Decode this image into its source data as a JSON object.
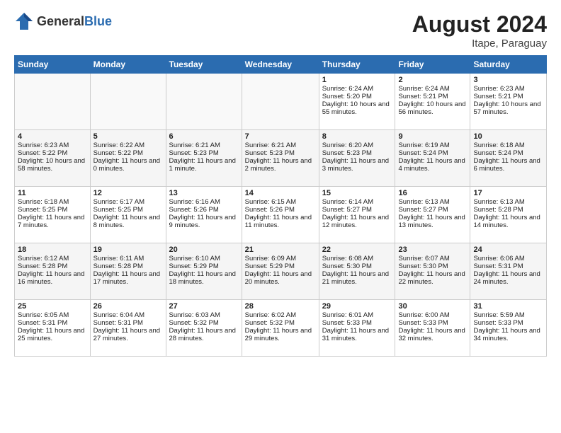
{
  "header": {
    "logo_general": "General",
    "logo_blue": "Blue",
    "month_year": "August 2024",
    "location": "Itape, Paraguay"
  },
  "days_of_week": [
    "Sunday",
    "Monday",
    "Tuesday",
    "Wednesday",
    "Thursday",
    "Friday",
    "Saturday"
  ],
  "weeks": [
    [
      {
        "day": "",
        "sunrise": "",
        "sunset": "",
        "daylight": "",
        "empty": true
      },
      {
        "day": "",
        "sunrise": "",
        "sunset": "",
        "daylight": "",
        "empty": true
      },
      {
        "day": "",
        "sunrise": "",
        "sunset": "",
        "daylight": "",
        "empty": true
      },
      {
        "day": "",
        "sunrise": "",
        "sunset": "",
        "daylight": "",
        "empty": true
      },
      {
        "day": "1",
        "sunrise": "Sunrise: 6:24 AM",
        "sunset": "Sunset: 5:20 PM",
        "daylight": "Daylight: 10 hours and 55 minutes.",
        "empty": false
      },
      {
        "day": "2",
        "sunrise": "Sunrise: 6:24 AM",
        "sunset": "Sunset: 5:21 PM",
        "daylight": "Daylight: 10 hours and 56 minutes.",
        "empty": false
      },
      {
        "day": "3",
        "sunrise": "Sunrise: 6:23 AM",
        "sunset": "Sunset: 5:21 PM",
        "daylight": "Daylight: 10 hours and 57 minutes.",
        "empty": false
      }
    ],
    [
      {
        "day": "4",
        "sunrise": "Sunrise: 6:23 AM",
        "sunset": "Sunset: 5:22 PM",
        "daylight": "Daylight: 10 hours and 58 minutes.",
        "empty": false
      },
      {
        "day": "5",
        "sunrise": "Sunrise: 6:22 AM",
        "sunset": "Sunset: 5:22 PM",
        "daylight": "Daylight: 11 hours and 0 minutes.",
        "empty": false
      },
      {
        "day": "6",
        "sunrise": "Sunrise: 6:21 AM",
        "sunset": "Sunset: 5:23 PM",
        "daylight": "Daylight: 11 hours and 1 minute.",
        "empty": false
      },
      {
        "day": "7",
        "sunrise": "Sunrise: 6:21 AM",
        "sunset": "Sunset: 5:23 PM",
        "daylight": "Daylight: 11 hours and 2 minutes.",
        "empty": false
      },
      {
        "day": "8",
        "sunrise": "Sunrise: 6:20 AM",
        "sunset": "Sunset: 5:23 PM",
        "daylight": "Daylight: 11 hours and 3 minutes.",
        "empty": false
      },
      {
        "day": "9",
        "sunrise": "Sunrise: 6:19 AM",
        "sunset": "Sunset: 5:24 PM",
        "daylight": "Daylight: 11 hours and 4 minutes.",
        "empty": false
      },
      {
        "day": "10",
        "sunrise": "Sunrise: 6:18 AM",
        "sunset": "Sunset: 5:24 PM",
        "daylight": "Daylight: 11 hours and 6 minutes.",
        "empty": false
      }
    ],
    [
      {
        "day": "11",
        "sunrise": "Sunrise: 6:18 AM",
        "sunset": "Sunset: 5:25 PM",
        "daylight": "Daylight: 11 hours and 7 minutes.",
        "empty": false
      },
      {
        "day": "12",
        "sunrise": "Sunrise: 6:17 AM",
        "sunset": "Sunset: 5:25 PM",
        "daylight": "Daylight: 11 hours and 8 minutes.",
        "empty": false
      },
      {
        "day": "13",
        "sunrise": "Sunrise: 6:16 AM",
        "sunset": "Sunset: 5:26 PM",
        "daylight": "Daylight: 11 hours and 9 minutes.",
        "empty": false
      },
      {
        "day": "14",
        "sunrise": "Sunrise: 6:15 AM",
        "sunset": "Sunset: 5:26 PM",
        "daylight": "Daylight: 11 hours and 11 minutes.",
        "empty": false
      },
      {
        "day": "15",
        "sunrise": "Sunrise: 6:14 AM",
        "sunset": "Sunset: 5:27 PM",
        "daylight": "Daylight: 11 hours and 12 minutes.",
        "empty": false
      },
      {
        "day": "16",
        "sunrise": "Sunrise: 6:13 AM",
        "sunset": "Sunset: 5:27 PM",
        "daylight": "Daylight: 11 hours and 13 minutes.",
        "empty": false
      },
      {
        "day": "17",
        "sunrise": "Sunrise: 6:13 AM",
        "sunset": "Sunset: 5:28 PM",
        "daylight": "Daylight: 11 hours and 14 minutes.",
        "empty": false
      }
    ],
    [
      {
        "day": "18",
        "sunrise": "Sunrise: 6:12 AM",
        "sunset": "Sunset: 5:28 PM",
        "daylight": "Daylight: 11 hours and 16 minutes.",
        "empty": false
      },
      {
        "day": "19",
        "sunrise": "Sunrise: 6:11 AM",
        "sunset": "Sunset: 5:28 PM",
        "daylight": "Daylight: 11 hours and 17 minutes.",
        "empty": false
      },
      {
        "day": "20",
        "sunrise": "Sunrise: 6:10 AM",
        "sunset": "Sunset: 5:29 PM",
        "daylight": "Daylight: 11 hours and 18 minutes.",
        "empty": false
      },
      {
        "day": "21",
        "sunrise": "Sunrise: 6:09 AM",
        "sunset": "Sunset: 5:29 PM",
        "daylight": "Daylight: 11 hours and 20 minutes.",
        "empty": false
      },
      {
        "day": "22",
        "sunrise": "Sunrise: 6:08 AM",
        "sunset": "Sunset: 5:30 PM",
        "daylight": "Daylight: 11 hours and 21 minutes.",
        "empty": false
      },
      {
        "day": "23",
        "sunrise": "Sunrise: 6:07 AM",
        "sunset": "Sunset: 5:30 PM",
        "daylight": "Daylight: 11 hours and 22 minutes.",
        "empty": false
      },
      {
        "day": "24",
        "sunrise": "Sunrise: 6:06 AM",
        "sunset": "Sunset: 5:31 PM",
        "daylight": "Daylight: 11 hours and 24 minutes.",
        "empty": false
      }
    ],
    [
      {
        "day": "25",
        "sunrise": "Sunrise: 6:05 AM",
        "sunset": "Sunset: 5:31 PM",
        "daylight": "Daylight: 11 hours and 25 minutes.",
        "empty": false
      },
      {
        "day": "26",
        "sunrise": "Sunrise: 6:04 AM",
        "sunset": "Sunset: 5:31 PM",
        "daylight": "Daylight: 11 hours and 27 minutes.",
        "empty": false
      },
      {
        "day": "27",
        "sunrise": "Sunrise: 6:03 AM",
        "sunset": "Sunset: 5:32 PM",
        "daylight": "Daylight: 11 hours and 28 minutes.",
        "empty": false
      },
      {
        "day": "28",
        "sunrise": "Sunrise: 6:02 AM",
        "sunset": "Sunset: 5:32 PM",
        "daylight": "Daylight: 11 hours and 29 minutes.",
        "empty": false
      },
      {
        "day": "29",
        "sunrise": "Sunrise: 6:01 AM",
        "sunset": "Sunset: 5:33 PM",
        "daylight": "Daylight: 11 hours and 31 minutes.",
        "empty": false
      },
      {
        "day": "30",
        "sunrise": "Sunrise: 6:00 AM",
        "sunset": "Sunset: 5:33 PM",
        "daylight": "Daylight: 11 hours and 32 minutes.",
        "empty": false
      },
      {
        "day": "31",
        "sunrise": "Sunrise: 5:59 AM",
        "sunset": "Sunset: 5:33 PM",
        "daylight": "Daylight: 11 hours and 34 minutes.",
        "empty": false
      }
    ]
  ]
}
